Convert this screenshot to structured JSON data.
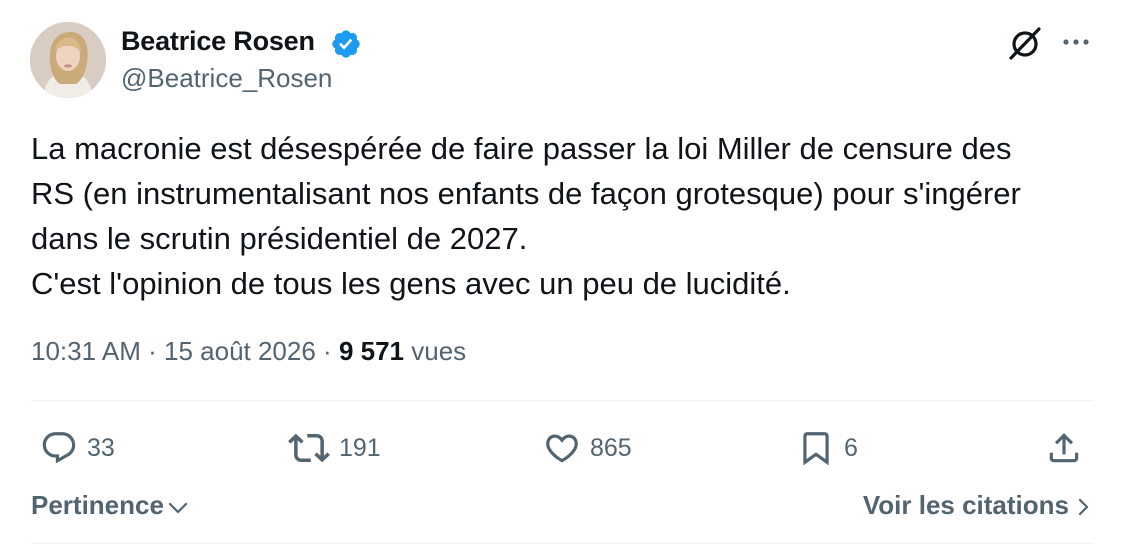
{
  "author": {
    "name": "Beatrice Rosen",
    "handle": "@Beatrice_Rosen",
    "verified": true,
    "verified_color": "#1d9bf0"
  },
  "header_icons": [
    "grok-icon",
    "more-icon"
  ],
  "tweet": {
    "text": "La macronie est désespérée de faire passer la loi Miller de censure des\nRS (en instrumentalisant nos enfants de façon grotesque) pour s'ingérer\ndans le scrutin présidentiel de 2027.\nC'est l'opinion de tous les gens avec un peu de lucidité."
  },
  "meta": {
    "time": "10:31 AM",
    "separator": "·",
    "date": "15 août 2026",
    "views_count": "9 571",
    "views_label": "vues"
  },
  "actions": {
    "replies": "33",
    "retweets": "191",
    "likes": "865",
    "bookmarks": "6"
  },
  "footer": {
    "sort_label": "Pertinence",
    "quotes_label": "Voir les citations"
  },
  "colors": {
    "text": "#0f1419",
    "secondary": "#536471",
    "divider": "#eff3f4"
  }
}
